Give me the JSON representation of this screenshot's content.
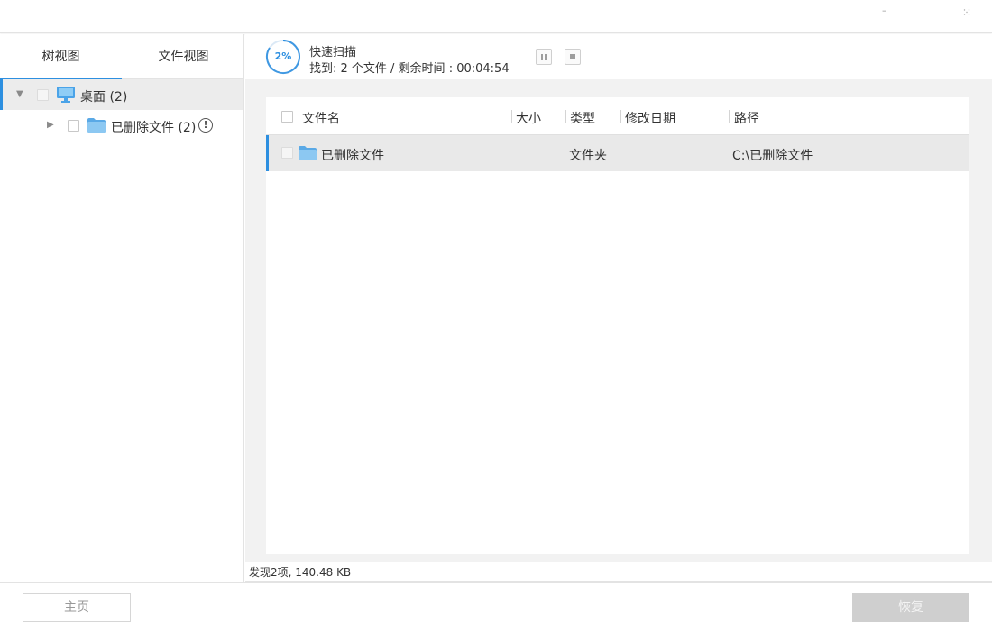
{
  "window": {
    "minimize_glyph": "–",
    "close_glyph": "⸱⸱"
  },
  "left_tabs": [
    {
      "label": "树视图"
    },
    {
      "label": "文件视图"
    }
  ],
  "tree": {
    "root": {
      "label": "桌面 (2)",
      "icon": "monitor-icon"
    },
    "child": {
      "label": "已删除文件 (2)",
      "icon": "folder-icon",
      "info_glyph": "!"
    }
  },
  "scan": {
    "percent": "2%",
    "progress_fraction": 0.02,
    "title": "快速扫描",
    "info": "找到: 2 个文件 /  剩余时间 : 00:04:54"
  },
  "table": {
    "headers": {
      "name": "文件名",
      "size": "大小",
      "type": "类型",
      "date": "修改日期",
      "path": "路径"
    },
    "rows": [
      {
        "name": "已删除文件",
        "size": "",
        "type": "文件夹",
        "date": "",
        "path": "C:\\已删除文件"
      }
    ]
  },
  "status": {
    "text": "发现2项, 140.48 KB"
  },
  "footer": {
    "home_label": "主页",
    "recover_label": "恢复"
  },
  "colors": {
    "accent": "#2d8fe0",
    "folder": "#5aa9e6",
    "disabled_button": "#cfcfcf"
  }
}
